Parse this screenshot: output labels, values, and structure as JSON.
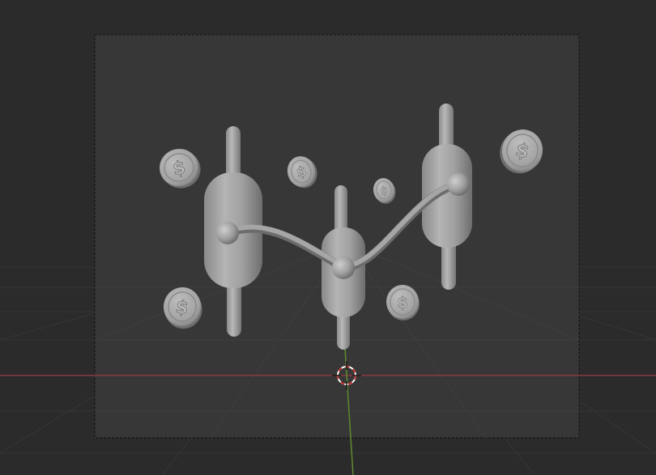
{
  "viewport": {
    "background_color": "#2b2b2b",
    "camera_frame_color": "#383838",
    "grid_color": "#373737",
    "x_axis_color": "#8a3a3f",
    "y_axis_color": "#5f8a2f",
    "cursor_color_primary": "#c83232",
    "cursor_color_secondary": "#ffffff"
  },
  "scene": {
    "model_color": "#a8a8a8",
    "objects": [
      "candlestick",
      "candlestick",
      "candlestick",
      "trend-line",
      "dollar-coin",
      "dollar-coin",
      "dollar-coin",
      "dollar-coin",
      "dollar-coin",
      "dollar-coin"
    ],
    "coin_symbol": "$"
  }
}
